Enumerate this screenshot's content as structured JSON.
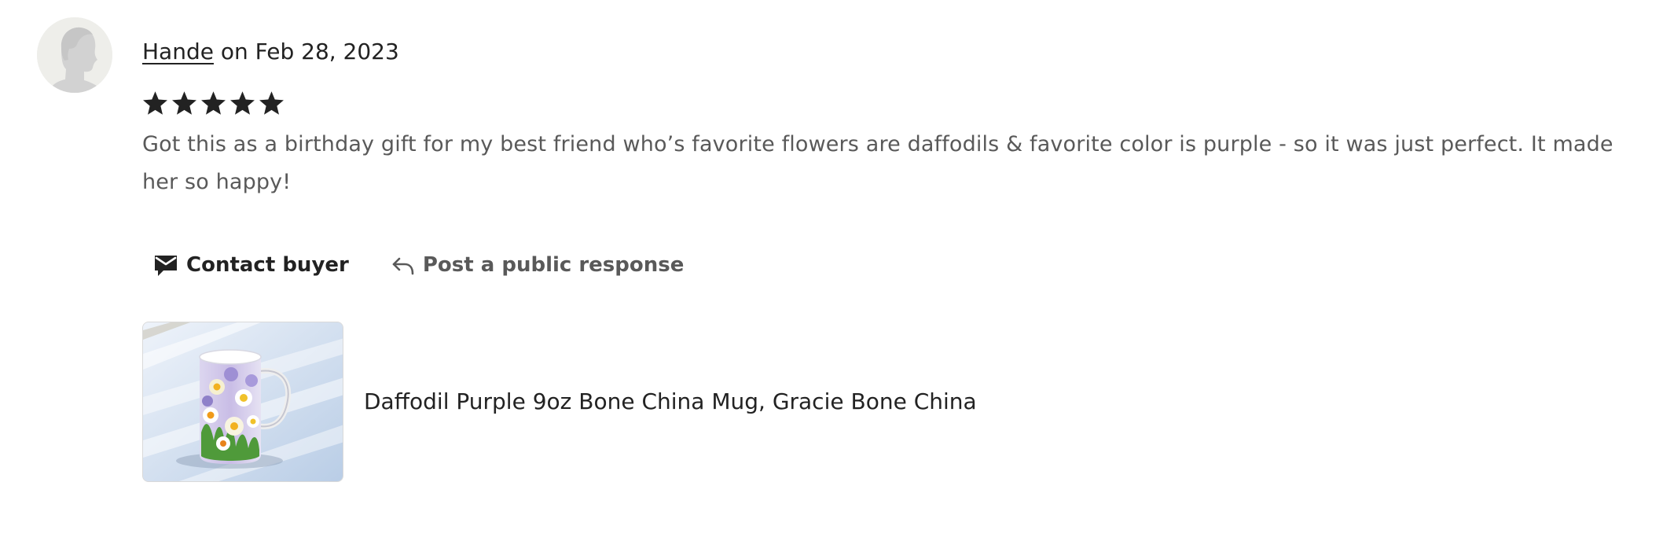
{
  "review": {
    "reviewer_name": "Hande",
    "date_text": "on Feb 28, 2023",
    "rating": 5,
    "rating_max": 5,
    "text": "Got this as a birthday gift for my best friend who’s favorite flowers are daffodils & favorite color is purple - so it was just perfect. It made her so happy!"
  },
  "actions": {
    "contact_label": "Contact buyer",
    "public_response_label": "Post a public response"
  },
  "listing": {
    "title": "Daffodil Purple 9oz Bone China Mug, Gracie Bone China"
  },
  "colors": {
    "text_primary": "#222222",
    "text_secondary": "#595959",
    "avatar_bg": "#eeeeea",
    "star": "#222222"
  },
  "icons": {
    "avatar": "default-user-silhouette-icon",
    "star": "star-filled-icon",
    "contact": "envelope-icon",
    "reply": "reply-arrow-icon"
  }
}
